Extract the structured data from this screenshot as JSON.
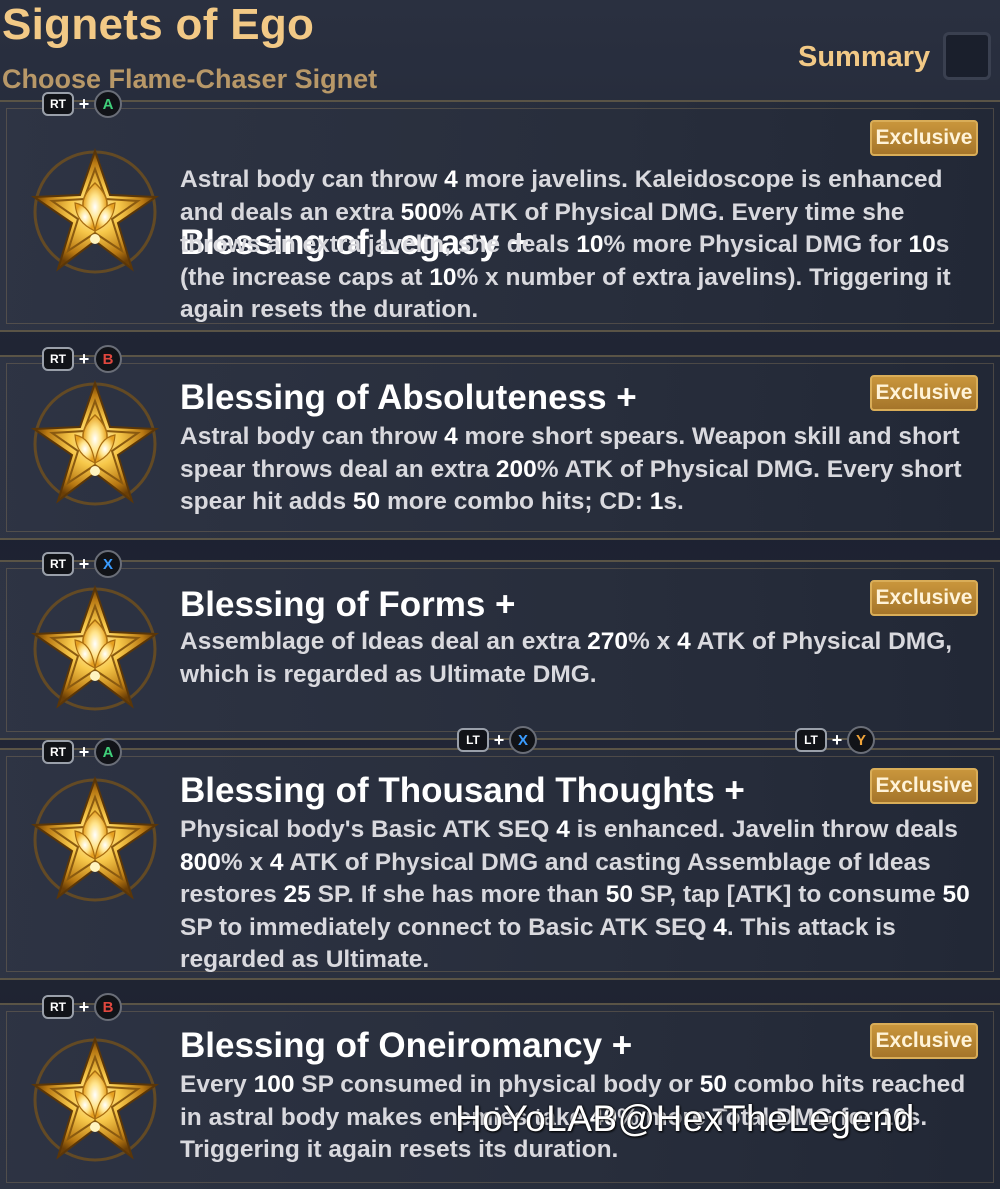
{
  "header": {
    "title": "Signets of Ego",
    "subtitle": "Choose Flame-Chaser Signet",
    "summary_label": "Summary"
  },
  "colors": {
    "gold_text": "#f2c986",
    "badge": "#b88532",
    "card_bg": "#2e3444",
    "btn_a": "#3fd07a",
    "btn_b": "#e0473e",
    "btn_x": "#3a9cff",
    "btn_y": "#f0a43a"
  },
  "cards": [
    {
      "combo": {
        "trigger": "RT",
        "plus": "+",
        "button": "A"
      },
      "title": "Blessing of Legacy +",
      "badge": "Exclusive",
      "description": "Astral body can throw 4 more javelins. Kaleidoscope is enhanced and deals an extra 500% ATK of Physical DMG. Every time she throws an extra javelin, she deals 10% more Physical DMG for 10s (the increase caps at 10% x number of extra javelins). Triggering it again resets the duration."
    },
    {
      "combo": {
        "trigger": "RT",
        "plus": "+",
        "button": "B"
      },
      "title": "Blessing of Absoluteness +",
      "badge": "Exclusive",
      "description": "Astral body can throw 4 more short spears. Weapon skill and short spear throws deal an extra 200% ATK of Physical DMG. Every short spear hit adds 50 more combo hits; CD: 1s."
    },
    {
      "combo": {
        "trigger": "RT",
        "plus": "+",
        "button": "X"
      },
      "title": "Blessing of Forms +",
      "badge": "Exclusive",
      "description": "Assemblage of Ideas deal an extra 270% x 4 ATK of Physical DMG, which is regarded as Ultimate DMG."
    },
    {
      "combo": {
        "trigger": "RT",
        "plus": "+",
        "button": "A"
      },
      "title": "Blessing of Thousand Thoughts +",
      "badge": "Exclusive",
      "description": "Physical body's Basic ATK SEQ 4 is enhanced. Javelin throw deals 800% x 4 ATK of Physical DMG and casting Assemblage of Ideas restores 25 SP. If she has more than 50 SP, tap [ATK] to consume 50 SP to immediately connect to Basic ATK SEQ 4. This attack is regarded as Ultimate."
    },
    {
      "combo": {
        "trigger": "RT",
        "plus": "+",
        "button": "B"
      },
      "title": "Blessing of Oneiromancy +",
      "badge": "Exclusive",
      "description": "Every 100 SP consumed in physical body or 50 combo hits reached in astral body makes enemies take 40% more Total DMG for 10s. Triggering it again resets its duration."
    }
  ],
  "floating_combos": [
    {
      "trigger": "LT",
      "plus": "+",
      "button": "X"
    },
    {
      "trigger": "LT",
      "plus": "+",
      "button": "Y"
    }
  ],
  "watermark": "HoYoLAB@HexTheLegend"
}
